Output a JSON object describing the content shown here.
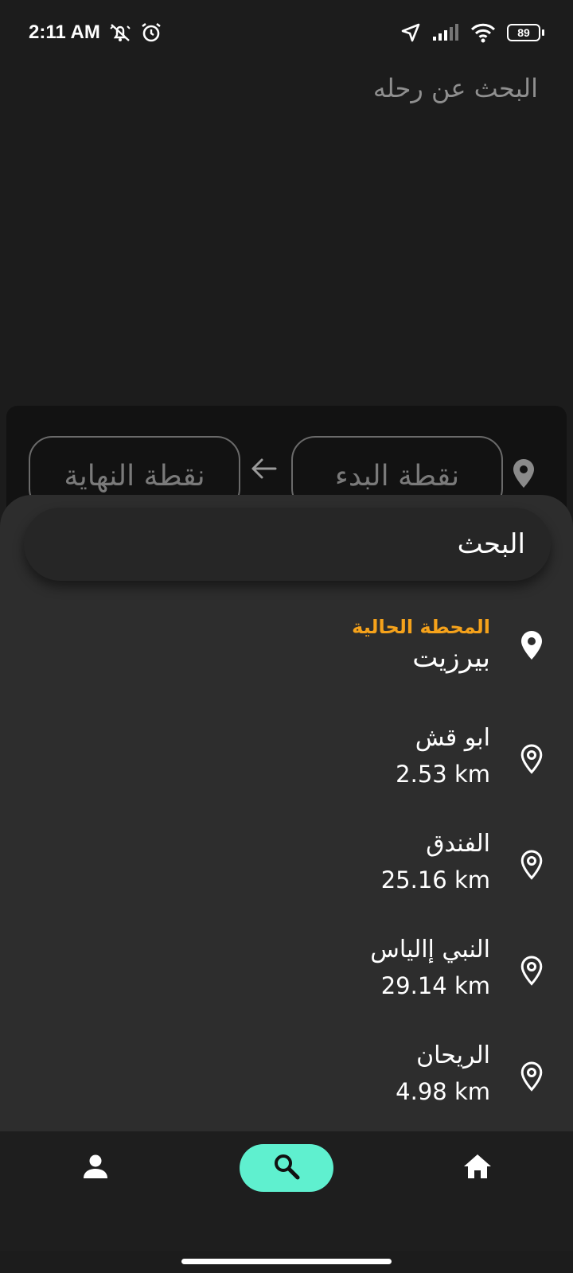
{
  "status_bar": {
    "time": "2:11 AM",
    "battery": "89",
    "icons": [
      "notifications-off-icon",
      "alarm-icon",
      "location-arrow-icon",
      "signal-icon",
      "wifi-icon",
      "battery-icon"
    ]
  },
  "page": {
    "title": "البحث عن رحله"
  },
  "route": {
    "start_placeholder": "نقطة البدء",
    "end_placeholder": "نقطة النهاية"
  },
  "search": {
    "placeholder": "البحث"
  },
  "stations": [
    {
      "label": "المحطة الحالية",
      "name": "بيرزيت",
      "icon": "location-pin-filled-icon"
    },
    {
      "name": "ابو قش",
      "distance": "2.53 km",
      "icon": "location-pin-outline-icon"
    },
    {
      "name": "الفندق",
      "distance": "25.16 km",
      "icon": "location-pin-outline-icon"
    },
    {
      "name": "النبي إالياس",
      "distance": "29.14 km",
      "icon": "location-pin-outline-icon"
    },
    {
      "name": "الريحان",
      "distance": "4.98 km",
      "icon": "location-pin-outline-icon"
    }
  ],
  "nav": {
    "items": [
      "person-icon",
      "search-icon",
      "home-icon"
    ],
    "active_color": "#5ff0cf"
  },
  "colors": {
    "background": "#1c1c1c",
    "sheet": "#2d2d2d",
    "accent_orange": "#f5a21b"
  }
}
